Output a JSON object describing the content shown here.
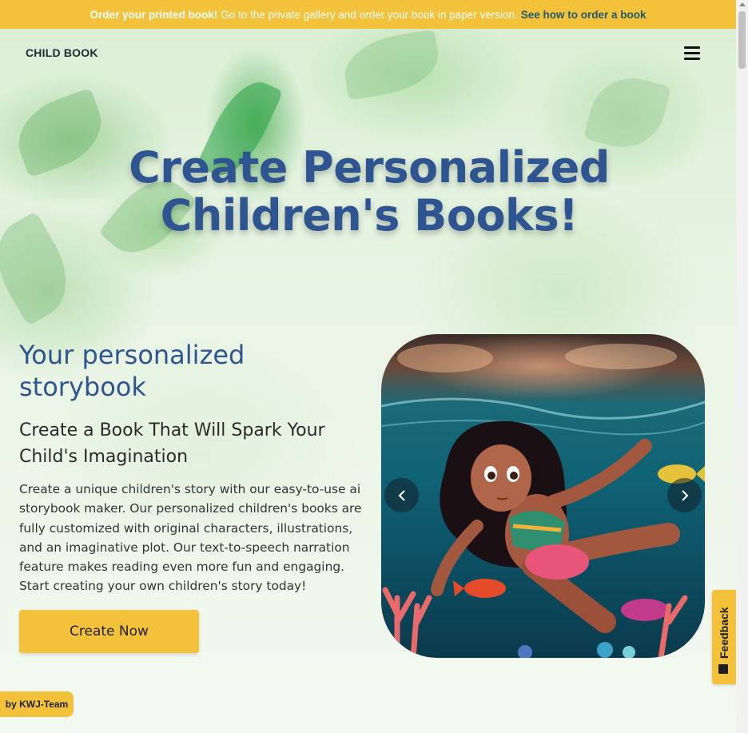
{
  "banner": {
    "bold": "Order your printed book!",
    "text": "Go to the private gallery and order your book in paper version.",
    "link": "See how to order a book"
  },
  "nav": {
    "brand": "CHILD BOOK",
    "menu_icon": "hamburger-menu-icon"
  },
  "hero": {
    "title": "Create Personalized Children's Books!"
  },
  "intro": {
    "heading": "Your personalized storybook",
    "subheading": "Create a Book That Will Spark Your Child's Imagination",
    "paragraph": "Create a unique children's story with our easy-to-use ai storybook maker. Our personalized children's books are fully customized with original characters, illustrations, and an imaginative plot. Our text-to-speech narration feature makes reading even more fun and engaging. Start creating your own children's story today!",
    "cta": "Create Now"
  },
  "carousel": {
    "prev_icon": "chevron-left-icon",
    "next_icon": "chevron-right-icon"
  },
  "feedback": {
    "label": "Feedback",
    "icon": "feedback-icon"
  },
  "credit": {
    "label": "by KWJ-Team"
  },
  "colors": {
    "accent": "#f4c13a",
    "title_blue": "#2f5591",
    "link_teal": "#1f5a6e"
  }
}
